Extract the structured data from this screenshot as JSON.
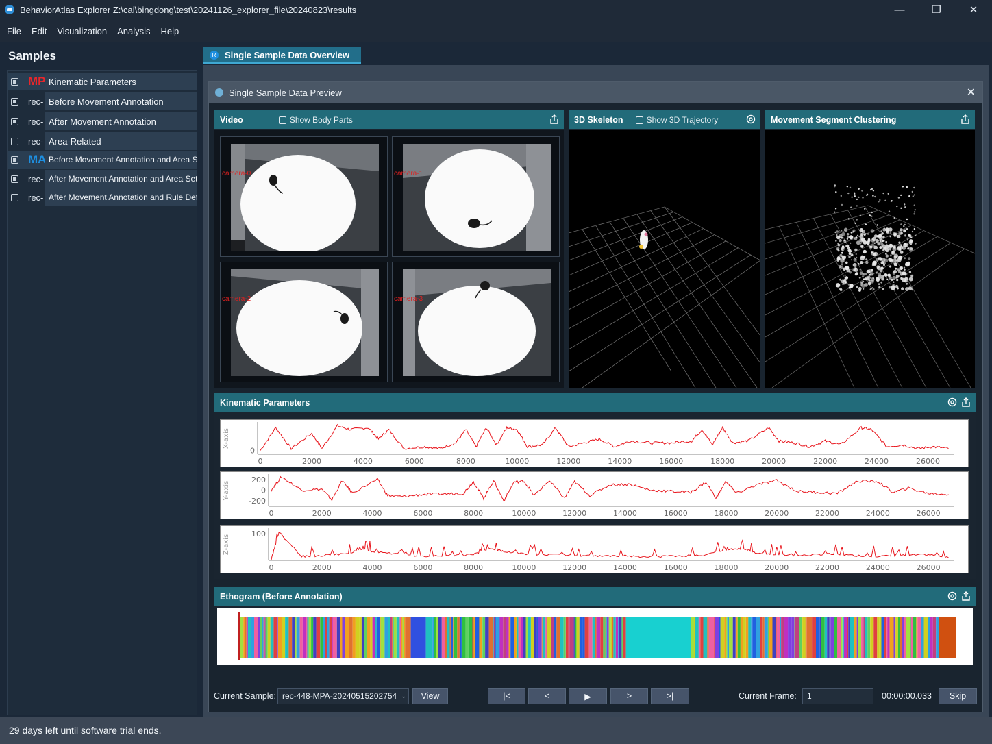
{
  "window": {
    "title": "BehaviorAtlas Explorer Z:\\cai\\bingdong\\test\\20241126_explorer_file\\20240823\\results",
    "minimize": "—",
    "maximize": "❐",
    "close": "✕"
  },
  "menu": [
    "File",
    "Edit",
    "Visualization",
    "Analysis",
    "Help"
  ],
  "sidebar": {
    "title": "Samples",
    "items": [
      {
        "prefix": "MP",
        "label": "Kinematic Parameters",
        "checked": true
      },
      {
        "prefix": "rec-",
        "label": "Before Movement Annotation",
        "checked": true
      },
      {
        "prefix": "rec-",
        "label": "After Movement Annotation",
        "checked": true
      },
      {
        "prefix": "rec-",
        "label": "Area-Related",
        "checked": false
      },
      {
        "prefix": "MA",
        "label": "Before Movement Annotation and Area Se",
        "checked": true
      },
      {
        "prefix": "rec-",
        "label": "After Movement Annotation and Area Setti",
        "checked": true
      },
      {
        "prefix": "rec-",
        "label": "After Movement Annotation and Rule Defir",
        "checked": false
      }
    ]
  },
  "tab": {
    "icon": "R",
    "label": "Single Sample Data Overview"
  },
  "preview": {
    "title": "Single Sample Data Preview",
    "close": "✕",
    "video": {
      "title": "Video",
      "checkbox": "Show Body Parts",
      "cameras": [
        "camera-0",
        "camera-1",
        "camera-2",
        "camera-3"
      ]
    },
    "skeleton": {
      "title": "3D Skeleton",
      "checkbox": "Show 3D Trajectory"
    },
    "clustering": {
      "title": "Movement Segment Clustering"
    },
    "kinematic": {
      "title": "Kinematic Parameters"
    },
    "ethogram": {
      "title": "Ethogram (Before Annotation)"
    }
  },
  "toolbar": {
    "current_sample_label": "Current Sample:",
    "current_sample_value": "rec-448-MPA-20240515202754",
    "view_button": "View",
    "first": "|<",
    "prev": "<",
    "play": "▶",
    "next": ">",
    "last": ">|",
    "current_frame_label": "Current Frame:",
    "current_frame_value": "1",
    "time": "00:00:00.033",
    "skip_button": "Skip"
  },
  "status": "29 days left until software trial ends.",
  "colors": {
    "accent": "#226b7a",
    "trace": "#e8141b",
    "brand_red": "#e8262b",
    "brand_blue": "#1e8fe0"
  },
  "chart_data": [
    {
      "type": "line",
      "ylabel": "X-axis",
      "y_ticks": [
        "0"
      ],
      "x_ticks": [
        "0",
        "2000",
        "4000",
        "6000",
        "8000",
        "10000",
        "12000",
        "14000",
        "16000",
        "18000",
        "20000",
        "22000",
        "24000",
        "26000"
      ],
      "xlim": [
        0,
        27000
      ],
      "series": [
        {
          "x": [
            0,
            600,
            1200,
            2000,
            2400,
            3000,
            3500,
            4200,
            4600,
            5000,
            5600,
            6400,
            7000,
            7600,
            8000,
            8400,
            8800,
            9200,
            9600,
            10000,
            10400,
            11000,
            11500,
            12000,
            12600,
            13200,
            13800,
            14400,
            15200,
            16000,
            16800,
            17200,
            17600,
            18000,
            18400,
            19000,
            19800,
            20200,
            20800,
            21400,
            22000,
            22600,
            23400,
            23800,
            24400,
            25000,
            25600,
            26200,
            26800
          ],
          "y": [
            0,
            1.2,
            0.1,
            0.9,
            0.1,
            1.3,
            1.1,
            1.2,
            0.6,
            1.1,
            0.1,
            0.2,
            0.1,
            0.4,
            1.1,
            0.2,
            1.2,
            0.3,
            1.2,
            1.1,
            0.2,
            0.3,
            1.2,
            0.2,
            0.4,
            0.6,
            0.2,
            0.5,
            0.4,
            0.4,
            0.5,
            1.1,
            0.3,
            1.2,
            0.4,
            0.5,
            1.2,
            0.5,
            0.4,
            0.2,
            0.5,
            0.3,
            1.2,
            1.1,
            0.2,
            0.3,
            0.1,
            0.2,
            0.1
          ]
        }
      ]
    },
    {
      "type": "line",
      "ylabel": "Y-axis",
      "y_ticks": [
        "200",
        "0",
        "-200"
      ],
      "x_ticks": [
        "0",
        "2000",
        "4000",
        "6000",
        "8000",
        "10000",
        "12000",
        "14000",
        "16000",
        "18000",
        "20000",
        "22000",
        "24000",
        "26000"
      ],
      "xlim": [
        0,
        27000
      ],
      "series": [
        {
          "x": [
            0,
            400,
            1200,
            2000,
            2400,
            2800,
            3200,
            4200,
            4600,
            5200,
            6000,
            6800,
            7600,
            8000,
            8400,
            8800,
            9200,
            9600,
            10000,
            10400,
            11000,
            11600,
            12000,
            12600,
            13400,
            14200,
            15000,
            15800,
            16600,
            17200,
            17600,
            18000,
            18400,
            19200,
            20000,
            20800,
            21600,
            22400,
            23200,
            24000,
            24600,
            25200,
            26000,
            26800
          ],
          "y": [
            0,
            250,
            0,
            20,
            -180,
            180,
            -50,
            200,
            -100,
            -120,
            -80,
            -70,
            -60,
            160,
            -150,
            180,
            -200,
            150,
            170,
            -100,
            180,
            -150,
            160,
            -100,
            100,
            110,
            0,
            -20,
            -40,
            150,
            -150,
            170,
            -60,
            100,
            180,
            -20,
            -40,
            -60,
            170,
            160,
            -40,
            40,
            -60,
            -80
          ]
        }
      ]
    },
    {
      "type": "line",
      "ylabel": "Z-axis",
      "y_ticks": [
        "100"
      ],
      "x_ticks": [
        "0",
        "2000",
        "4000",
        "6000",
        "8000",
        "10000",
        "12000",
        "14000",
        "16000",
        "18000",
        "20000",
        "22000",
        "24000",
        "26000"
      ],
      "xlim": [
        0,
        27000
      ],
      "series": [
        {
          "x": [
            0,
            300,
            1200,
            2000,
            3000,
            3600,
            4000,
            5000,
            6000,
            7000,
            8000,
            8600,
            9200,
            10000,
            11000,
            12000,
            13000,
            14000,
            15000,
            16000,
            17000,
            18000,
            18600,
            19200,
            20000,
            21000,
            22000,
            23000,
            24000,
            25000,
            26000,
            26800
          ],
          "y": [
            0,
            100,
            10,
            15,
            20,
            40,
            30,
            20,
            12,
            15,
            18,
            40,
            30,
            20,
            18,
            15,
            14,
            12,
            10,
            12,
            15,
            35,
            40,
            25,
            18,
            15,
            20,
            15,
            12,
            15,
            18,
            10
          ]
        }
      ]
    }
  ]
}
